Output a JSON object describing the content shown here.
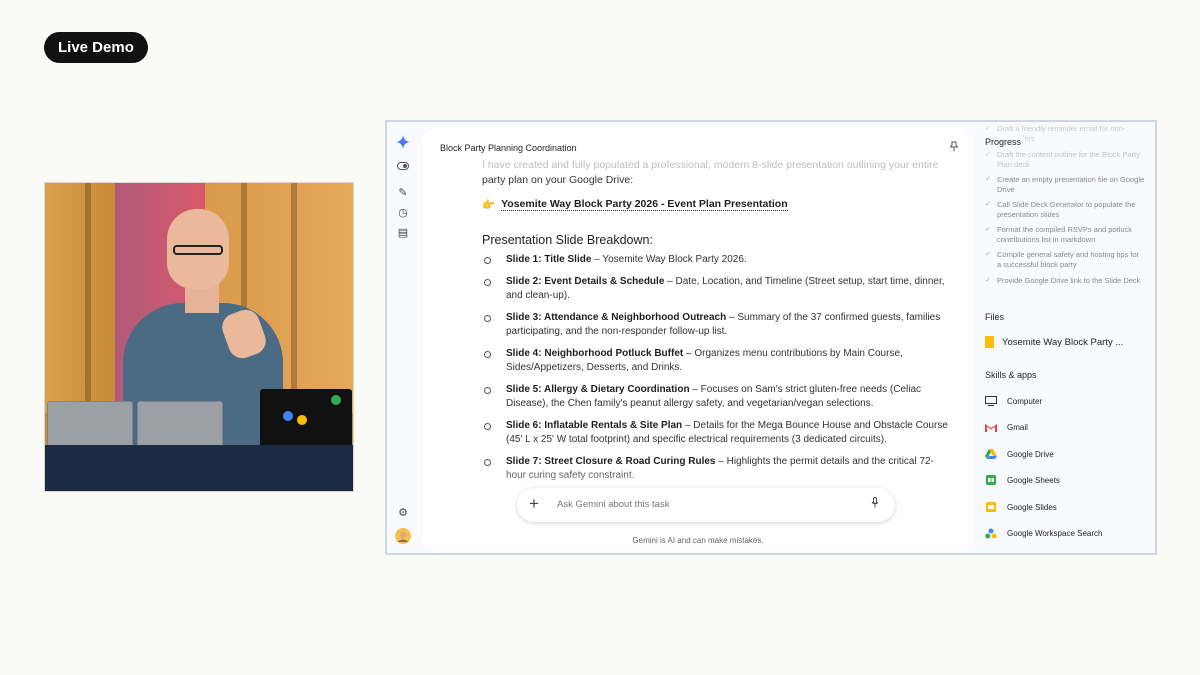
{
  "badge": "Live Demo",
  "chat": {
    "title": "Block Party Planning Coordination",
    "faded_intro": "I have created and fully populated a professional, modern 8-slide presentation outlining your entire",
    "intro_tail": "party plan on your Google Drive:",
    "doc_emoji": "👉",
    "doc_link": "Yosemite Way Block Party 2026 - Event Plan Presentation",
    "section_heading": "Presentation Slide Breakdown:",
    "slides": [
      {
        "title": "Slide 1: Title Slide",
        "desc": " – Yosemite Way Block Party 2026."
      },
      {
        "title": "Slide 2: Event Details & Schedule",
        "desc": " – Date, Location, and Timeline (Street setup, start time, dinner, and clean-up)."
      },
      {
        "title": "Slide 3: Attendance & Neighborhood Outreach",
        "desc": " – Summary of the 37 confirmed guests, families participating, and the non-responder follow-up list."
      },
      {
        "title": "Slide 4: Neighborhood Potluck Buffet",
        "desc": " – Organizes menu contributions by Main Course, Sides/Appetizers, Desserts, and Drinks."
      },
      {
        "title": "Slide 5: Allergy & Dietary Coordination",
        "desc": " – Focuses on Sam's strict gluten-free needs (Celiac Disease), the Chen family's peanut allergy safety, and vegetarian/vegan selections."
      },
      {
        "title": "Slide 6: Inflatable Rentals & Site Plan",
        "desc": " – Details for the Mega Bounce House and Obstacle Course (45' L x 25' W total footprint) and specific electrical requirements (3 dedicated circuits)."
      },
      {
        "title": "Slide 7: Street Closure & Road Curing Rules",
        "desc": " – Highlights the permit details and the critical 72-hour curing safety constraint."
      }
    ],
    "input_placeholder": "Ask Gemini about this task",
    "disclaimer": "Gemini is AI and can make mistakes."
  },
  "side": {
    "progress_heading": "Progress",
    "progress_items": [
      "Draft a friendly reminder email for non-responders",
      "Draft the content outline for the Block Party Plan deck",
      "Create an empty presentation file on Google Drive",
      "Call Slide Deck Generator to populate the presentation slides",
      "Format the compiled RSVPs and potluck contributions list in markdown",
      "Compile general safety and hosting tips for a successful block party",
      "Provide Google Drive link to the Slide Deck"
    ],
    "files_heading": "Files",
    "file_name": "Yosemite Way Block Party ...",
    "skills_heading": "Skills & apps",
    "apps": [
      "Computer",
      "Gmail",
      "Google Drive",
      "Google Sheets",
      "Google Slides",
      "Google Workspace Search"
    ]
  },
  "colors": {
    "slides_yellow": "#fbbc04",
    "gmail_red": "#ea4335",
    "sheets_green": "#34a853",
    "drive_blue": "#4285f4"
  }
}
